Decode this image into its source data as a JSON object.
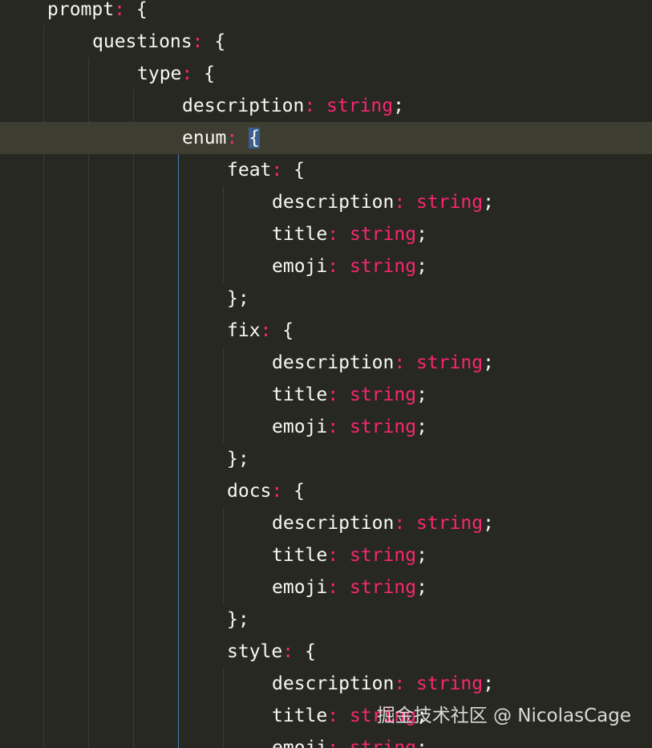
{
  "colors": {
    "background": "#272822",
    "current_line": "#3e3d32",
    "key": "#f8f8f2",
    "keyword": "#f92672",
    "bracket_highlight": "#3b5f8f",
    "indent_guide": "#3a3a33",
    "active_indent_guide": "#4a7db5"
  },
  "code": {
    "keys": {
      "prompt": "prompt",
      "questions": "questions",
      "type": "type",
      "description": "description",
      "enum": "enum",
      "feat": "feat",
      "fix": "fix",
      "docs": "docs",
      "style": "style",
      "title": "title",
      "emoji": "emoji"
    },
    "type_name": "string",
    "colon": ":",
    "open_brace": "{",
    "close_brace": "};",
    "semicolon": ";"
  },
  "watermark": {
    "text": "掘金技术社区 @ NicolasCage"
  }
}
